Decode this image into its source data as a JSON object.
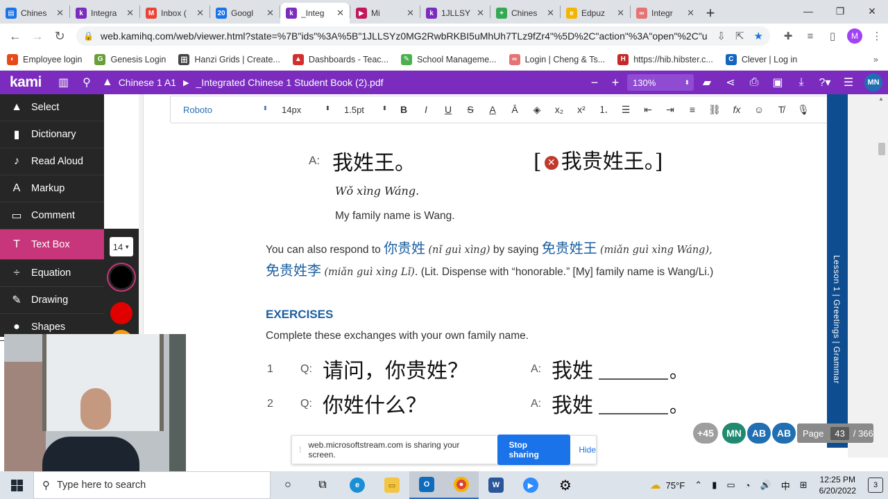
{
  "browser": {
    "tabs": [
      {
        "title": "Chines",
        "color": "#1a73e8",
        "glyph": "▤"
      },
      {
        "title": "Integra",
        "color": "#7b2cbf",
        "glyph": "k"
      },
      {
        "title": "Inbox (",
        "color": "#ea4335",
        "glyph": "M"
      },
      {
        "title": "Googl",
        "color": "#1a73e8",
        "glyph": "20"
      },
      {
        "title": "_Integ",
        "color": "#7b2cbf",
        "glyph": "k"
      },
      {
        "title": "Mi",
        "color": "#c2185b",
        "glyph": "▶"
      },
      {
        "title": "1JLLSY",
        "color": "#7b2cbf",
        "glyph": "k"
      },
      {
        "title": "Chines",
        "color": "#34a853",
        "glyph": "+"
      },
      {
        "title": "Edpuz",
        "color": "#f2b600",
        "glyph": "e"
      },
      {
        "title": "Integr",
        "color": "#e57373",
        "glyph": "∞"
      }
    ],
    "active_tab_index": 4,
    "url": "web.kamihq.com/web/viewer.html?state=%7B\"ids\"%3A%5B\"1JLLSYz0MG2RwbRKBI5uMhUh7TLz9fZr4\"%5D%2C\"action\"%3A\"open\"%2C\"u...",
    "profile_initial": "M",
    "bookmarks": [
      {
        "label": "Employee login",
        "color": "#e64a19",
        "glyph": "◐"
      },
      {
        "label": "Genesis Login",
        "color": "#689f38",
        "glyph": "G"
      },
      {
        "label": "Hanzi Grids | Create...",
        "color": "#444444",
        "glyph": "田"
      },
      {
        "label": "Dashboards - Teac...",
        "color": "#d32f2f",
        "glyph": "▲"
      },
      {
        "label": "School Manageme...",
        "color": "#4caf50",
        "glyph": "✎"
      },
      {
        "label": "Login | Cheng & Ts...",
        "color": "#e57373",
        "glyph": "∞"
      },
      {
        "label": "https://hib.hibster.c...",
        "color": "#c62828",
        "glyph": "H"
      },
      {
        "label": "Clever | Log in",
        "color": "#1565c0",
        "glyph": "C"
      }
    ]
  },
  "kami": {
    "logo": "kami",
    "breadcrumb": [
      "Chinese 1 A1",
      "_Integrated Chinese 1 Student Book (2).pdf"
    ],
    "zoom": "130%",
    "user_initials": "MN",
    "tools": [
      {
        "label": "Select",
        "icon": "▲"
      },
      {
        "label": "Dictionary",
        "icon": "▮"
      },
      {
        "label": "Read Aloud",
        "icon": "♪"
      },
      {
        "label": "Markup",
        "icon": "A"
      },
      {
        "label": "Comment",
        "icon": "▭"
      },
      {
        "label": "Text Box",
        "icon": "T"
      },
      {
        "label": "Equation",
        "icon": "÷"
      },
      {
        "label": "Drawing",
        "icon": "✎"
      },
      {
        "label": "Shapes",
        "icon": "●"
      }
    ],
    "active_tool": "Text Box",
    "textbox_font_size": "14",
    "colors": [
      "#000000",
      "#e00000",
      "#f39c12"
    ],
    "text_toolbar": {
      "font": "Roboto",
      "size": "14px",
      "stroke": "1.5pt"
    },
    "collaborators": [
      {
        "label": "+45",
        "color": "#9e9e9e"
      },
      {
        "label": "MN",
        "color": "#1f8a70"
      },
      {
        "label": "AB",
        "color": "#1f6fb2"
      },
      {
        "label": "AB",
        "color": "#1f6fb2"
      }
    ],
    "page_indicator": {
      "label": "Page",
      "current": "43",
      "total": "/ 366"
    }
  },
  "document": {
    "line_a_label": "A:",
    "line_a_text": "我姓王。",
    "line_a_bracket": "我贵姓王。",
    "pinyin": "Wǒ xìng Wáng.",
    "translation": "My family name is Wang.",
    "para1_pre": "You can also respond to",
    "para1_cn1": "你贵姓",
    "para1_py1": "(nǐ guì xìng)",
    "para1_mid": "by saying",
    "para1_cn2": "免贵姓王",
    "para1_py2": "(miǎn guì xìng Wáng),",
    "para2_cn": "免贵姓李",
    "para2_py": "(miǎn guì xìng Lǐ).",
    "para2_rest": "(Lit. Dispense with “honorable.” [My] family name is Wang/Li.)",
    "exercises_heading": "EXERCISES",
    "exercises_instr": "Complete these exchanges with your own family name.",
    "exercises": [
      {
        "num": "1",
        "q_label": "Q:",
        "question": "请问，你贵姓？",
        "a_label": "A:",
        "answer": "我姓",
        "end": "。"
      },
      {
        "num": "2",
        "q_label": "Q:",
        "question": "你姓什么？",
        "a_label": "A:",
        "answer": "我姓",
        "end": "。"
      }
    ],
    "side_band": "Lesson 1  |  Greetings  |  Grammar"
  },
  "share_banner": {
    "text": "web.microsoftstream.com is sharing your screen.",
    "stop": "Stop sharing",
    "hide": "Hide"
  },
  "taskbar": {
    "search_placeholder": "Type here to search",
    "weather": "75°F",
    "ime": "中",
    "time": "12:25 PM",
    "date": "6/20/2022",
    "notifications": "3"
  }
}
